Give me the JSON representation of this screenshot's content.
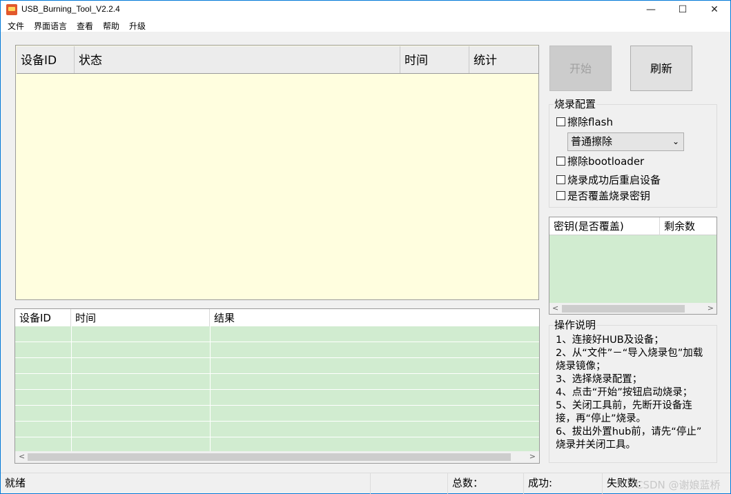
{
  "window": {
    "title": "USB_Burning_Tool_V2.2.4",
    "min_icon": "—",
    "max_icon": "☐",
    "close_icon": "✕"
  },
  "menu": [
    "文件",
    "界面语言",
    "查看",
    "帮助",
    "升级"
  ],
  "device_table": {
    "headers": [
      "设备ID",
      "状态",
      "时间",
      "统计"
    ],
    "rows": []
  },
  "buttons": {
    "start": "开始",
    "refresh": "刷新"
  },
  "burn_config": {
    "title": "烧录配置",
    "erase_flash": "擦除flash",
    "erase_mode": "普通擦除",
    "erase_bootloader": "擦除bootloader",
    "reboot_after": "烧录成功后重启设备",
    "overwrite_key": "是否覆盖烧录密钥"
  },
  "key_table": {
    "headers": [
      "密钥(是否覆盖)",
      "剩余数"
    ],
    "rows": []
  },
  "result_table": {
    "headers": [
      "设备ID",
      "时间",
      "结果"
    ],
    "rows": []
  },
  "instructions": {
    "title": "操作说明",
    "lines": [
      "1、连接好HUB及设备；",
      "2、从“文件”－“导入烧录包”加载",
      "烧录镜像；",
      "3、选择烧录配置；",
      "4、点击“开始”按钮启动烧录；",
      "5、关闭工具前，先断开设备连",
      "接，再“停止”烧录。",
      "6、拔出外置hub前，请先“停止”",
      "烧录并关闭工具。"
    ]
  },
  "status": {
    "ready": "就绪",
    "total_label": "总数：",
    "success_label": "成功:",
    "fail_label": "失败数:",
    "watermark": "CSDN @谢娘蓝桥"
  },
  "colors": {
    "device_table_bg": "#fffedf",
    "result_table_bg": "#d1ecd0",
    "border": "#9a9a9a"
  }
}
